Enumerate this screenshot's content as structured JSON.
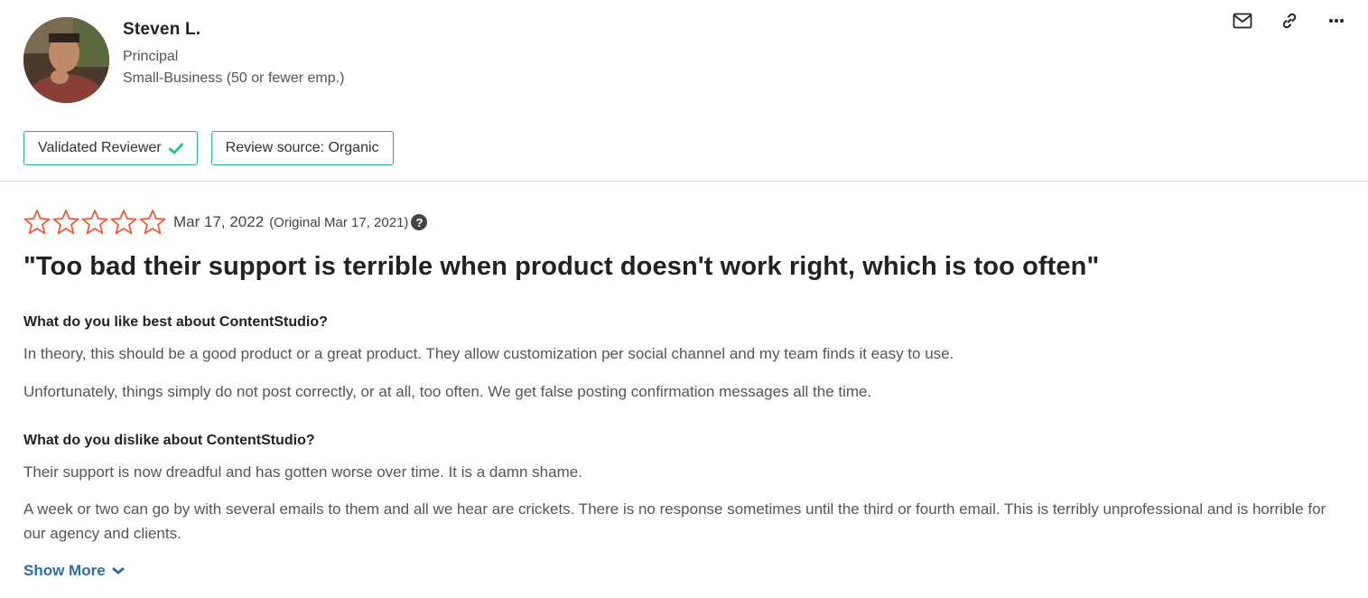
{
  "reviewer": {
    "name": "Steven L.",
    "role": "Principal",
    "company_size": "Small-Business (50 or fewer emp.)"
  },
  "actions": [
    {
      "icon": "mail-icon"
    },
    {
      "icon": "link-icon"
    },
    {
      "icon": "more-icon"
    }
  ],
  "badges": {
    "validated": "Validated Reviewer",
    "source": "Review source: Organic"
  },
  "review": {
    "rating": 0,
    "rating_max": 5,
    "date": "Mar 17, 2022",
    "original": "(Original Mar 17, 2021)",
    "help_icon": "?",
    "title": "\"Too bad their support is terrible when product doesn't work right, which is too often\"",
    "like_question": "What do you like best about ContentStudio?",
    "like_answer_1": "In theory, this should be a good product or a great product. They allow customization per social channel and my team finds it easy to use.",
    "like_answer_2": "Unfortunately, things simply do not post correctly, or at all, too often. We get false posting confirmation messages all the time.",
    "dislike_question": "What do you dislike about ContentStudio?",
    "dislike_answer_1": "Their support is now dreadful and has gotten worse over time. It is a damn shame.",
    "dislike_answer_2": "A week or two can go by with several emails to them and all we hear are crickets. There is no response sometimes until the third or fourth email. This is terribly unprofessional and is horrible for our agency and clients.",
    "show_more": "Show More"
  },
  "colors": {
    "star": "#ef5a3c",
    "badge_border": "#27a9a0",
    "check": "#27c2a0",
    "link": "#2d6f9f"
  }
}
